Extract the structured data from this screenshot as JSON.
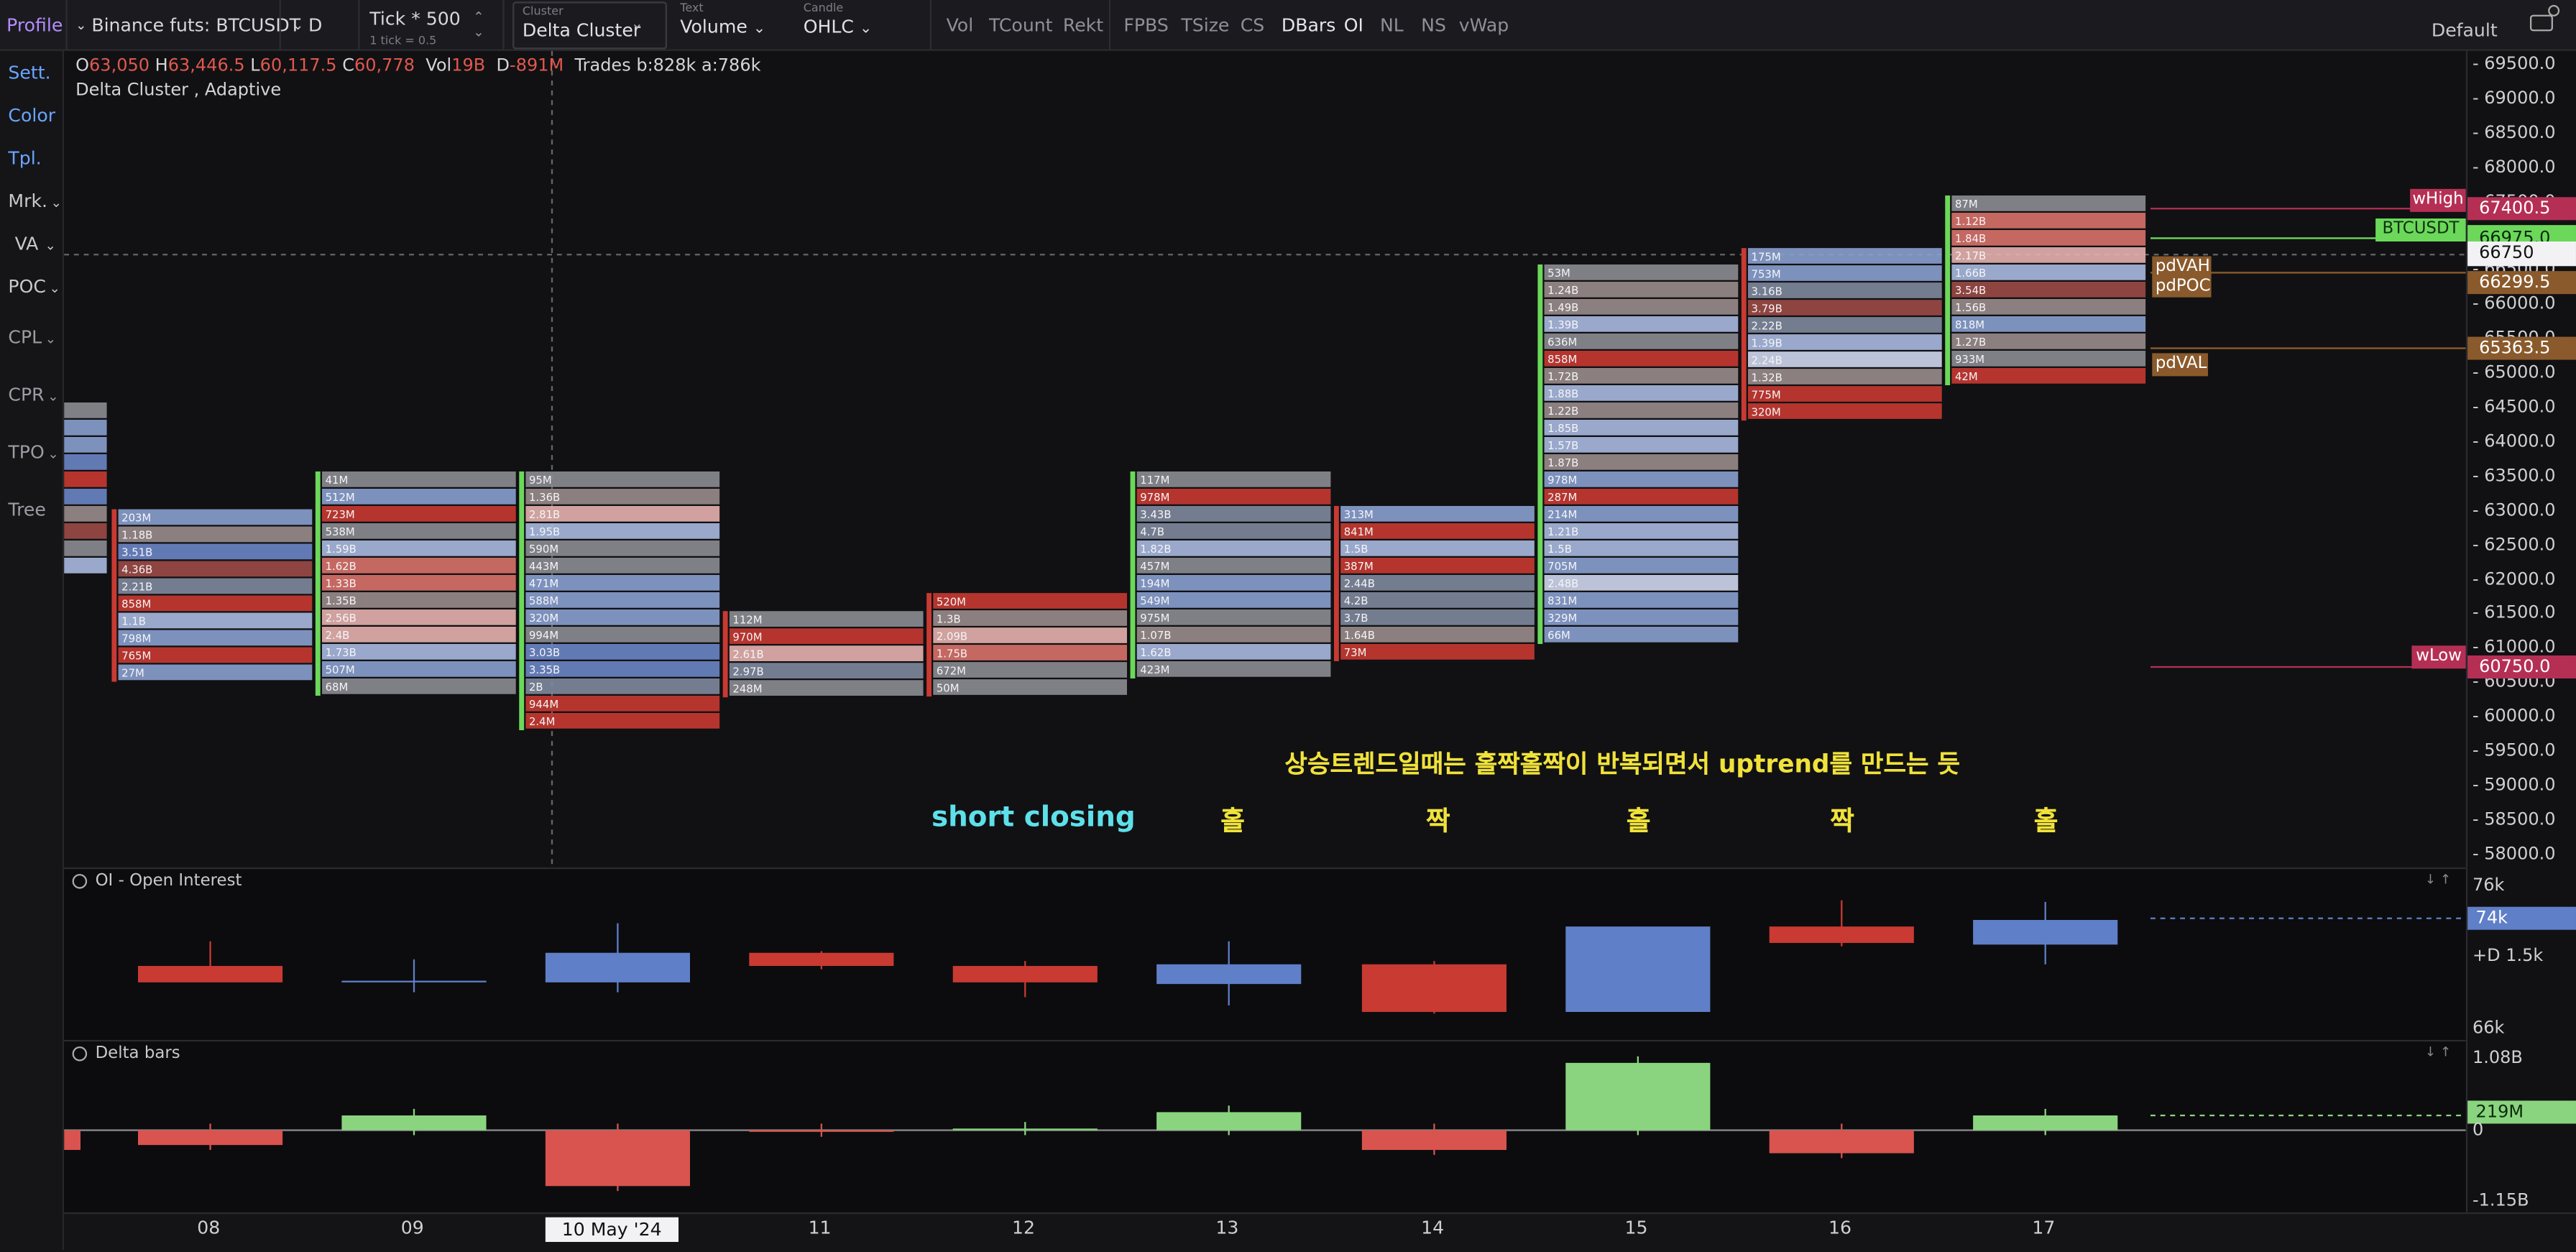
{
  "toolbar": {
    "profile": "Profile",
    "symbol": "Binance futs: BTCUSDT",
    "timeframe": "D",
    "tick": "Tick * 500",
    "tick_sub": "1 tick = 0.5",
    "cluster_label": "Cluster",
    "cluster_value": "Delta Cluster",
    "text_label": "Text",
    "text_value": "Volume",
    "candle_label": "Candle",
    "candle_value": "OHLC",
    "flags": [
      "Vol",
      "TCount",
      "Rekt",
      "FPBS",
      "TSize",
      "CS",
      "DBars",
      "OI",
      "NL",
      "NS",
      "vWap"
    ],
    "layout": "Default"
  },
  "sidebar": [
    "Sett.",
    "Color",
    "Tpl.",
    "Mrk.",
    "VA",
    "POC",
    "CPL",
    "CPR",
    "TPO",
    "Tree"
  ],
  "ohlc": {
    "o_label": "O",
    "o": "63,050",
    "h_label": "H",
    "h": "63,446.5",
    "l_label": "L",
    "l": "60,117.5",
    "c_label": "C",
    "c": "60,778",
    "vol_label": "Vol",
    "vol": "19B",
    "d_label": "D",
    "d": "-891M",
    "trades": "Trades b:828k a:786k"
  },
  "indicator_name": "Delta Cluster , Adaptive",
  "annotations": {
    "korean": "상승트렌드일때는 홀짝홀짝이 반복되면서 uptrend를 만드는 듯",
    "short_closing": "short closing",
    "marks": [
      "홀",
      "짝",
      "홀",
      "짝",
      "홀"
    ]
  },
  "levels": {
    "wHigh": "wHigh",
    "wHigh_price": "67400.5",
    "symbol_tag": "BTCUSDT",
    "last_price": "66750",
    "last_price_hidden": "66975.0",
    "pdVAH": "pdVAH",
    "pdPOC": "pdPOC",
    "pdPOC_price": "66299.5",
    "pdVAL": "pdVAL",
    "pdVAL_price": "65363.5",
    "wLow": "wLow",
    "wLow_price": "60750.0"
  },
  "price_axis": [
    "69500.0",
    "69000.0",
    "68500.0",
    "68000.0",
    "67500.0",
    "67000.0",
    "66500.0",
    "66000.0",
    "65500.0",
    "65000.0",
    "64500.0",
    "64000.0",
    "63500.0",
    "63000.0",
    "62500.0",
    "62000.0",
    "61500.0",
    "61000.0",
    "60500.0",
    "60000.0",
    "59500.0",
    "59000.0",
    "58500.0",
    "58000.0"
  ],
  "oi_pane": {
    "title": "OI - Open Interest",
    "axis_top": "76k",
    "axis_value": "74k",
    "axis_mid": "+D 1.5k",
    "axis_bottom": "66k"
  },
  "delta_pane": {
    "title": "Delta bars",
    "axis_top": "1.08B",
    "axis_value": "219M",
    "axis_zero": "0",
    "axis_bottom": "-1.15B"
  },
  "time_axis": [
    "08",
    "09",
    "10 May '24",
    "11",
    "12",
    "13",
    "14",
    "15",
    "16",
    "17"
  ],
  "colors": {
    "up": "#5f7fc8",
    "down": "#c83a32",
    "delta_up": "#8ad47f",
    "delta_down": "#d9534f",
    "whigh": "#b52f55",
    "pd": "#8a5a2c",
    "symbol_green": "#6bd85a"
  },
  "clusters": [
    {
      "day": "08",
      "labels": [
        "203M",
        "1.18B",
        "3.51B",
        "4.36B",
        "2.21B",
        "858M",
        "1.1B",
        "798M",
        "765M",
        "27M"
      ]
    },
    {
      "day": "09",
      "labels": [
        "41M",
        "512M",
        "723M",
        "538M",
        "1.59B",
        "1.62B",
        "1.33B",
        "1.35B",
        "2.56B",
        "2.4B",
        "1.73B",
        "507M",
        "68M"
      ]
    },
    {
      "day": "10",
      "labels": [
        "95M",
        "1.36B",
        "2.81B",
        "1.95B",
        "590M",
        "443M",
        "471M",
        "588M",
        "320M",
        "994M",
        "3.03B",
        "3.35B",
        "2B",
        "944M",
        "2.4M"
      ]
    },
    {
      "day": "11",
      "labels": [
        "112M",
        "970M",
        "2.61B",
        "2.97B",
        "248M"
      ]
    },
    {
      "day": "12",
      "labels": [
        "520M",
        "1.3B",
        "2.09B",
        "1.75B",
        "672M",
        "50M"
      ]
    },
    {
      "day": "13",
      "labels": [
        "117M",
        "978M",
        "3.43B",
        "4.7B",
        "1.82B",
        "457M",
        "194M",
        "549M",
        "975M",
        "1.07B",
        "1.62B",
        "423M"
      ]
    },
    {
      "day": "14",
      "labels": [
        "313M",
        "841M",
        "1.5B",
        "387M",
        "2.44B",
        "4.2B",
        "3.7B",
        "1.64B",
        "73M"
      ]
    },
    {
      "day": "15",
      "labels": [
        "53M",
        "1.24B",
        "1.49B",
        "1.39B",
        "636M",
        "858M",
        "1.72B",
        "1.88B",
        "1.22B",
        "1.85B",
        "1.57B",
        "1.87B",
        "978M",
        "287M",
        "214M",
        "1.21B",
        "1.5B",
        "705M",
        "2.48B",
        "831M",
        "329M",
        "66M"
      ]
    },
    {
      "day": "16",
      "labels": [
        "175M",
        "753M",
        "3.16B",
        "3.79B",
        "2.22B",
        "1.39B",
        "2.24B",
        "1.32B",
        "775M",
        "320M"
      ]
    },
    {
      "day": "17",
      "labels": [
        "87M",
        "1.12B",
        "1.84B",
        "2.17B",
        "1.66B",
        "3.54B",
        "1.56B",
        "818M",
        "1.27B",
        "933M",
        "42M"
      ]
    }
  ]
}
